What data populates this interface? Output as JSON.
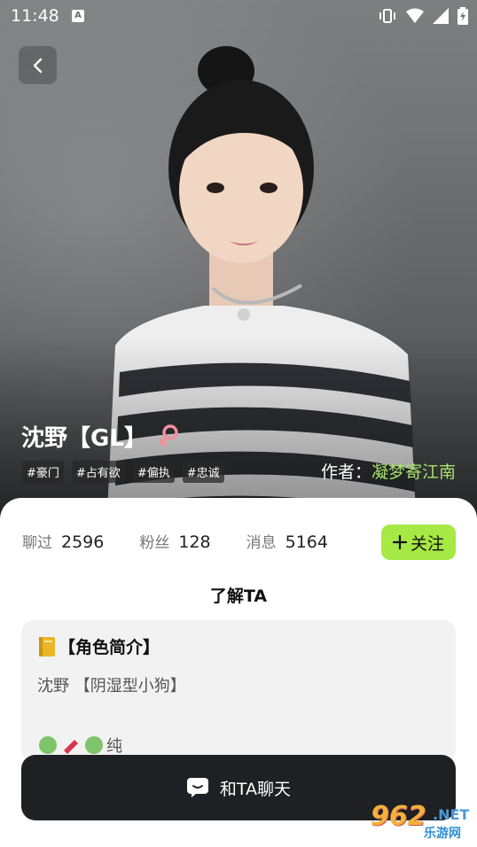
{
  "status_bar": {
    "time": "11:48",
    "keyboard_indicator": "A"
  },
  "character": {
    "name": "沈野【GL】",
    "gender_icon": "female-icon",
    "tags": [
      "#豪门",
      "#占有欲",
      "#偏执",
      "#忠诚"
    ],
    "author_label": "作者：",
    "author_name": "凝梦寄江南"
  },
  "stats": {
    "chatted_label": "聊过",
    "chatted_value": "2596",
    "fans_label": "粉丝",
    "fans_value": "128",
    "messages_label": "消息",
    "messages_value": "5164"
  },
  "follow_button": {
    "label": "关注"
  },
  "section_title": "了解TA",
  "intro_card": {
    "title": "【角色简介】",
    "line1": "沈野  【阴湿型小狗】",
    "line2_partial": "纯"
  },
  "chat_button": {
    "label": "和TA聊天"
  },
  "watermark": {
    "number": "962",
    "suffix": ".NET",
    "site": "乐游网"
  },
  "colors": {
    "accent_green": "#a6e844",
    "author_green": "#a6e36b",
    "dark_button": "#1e2023"
  }
}
